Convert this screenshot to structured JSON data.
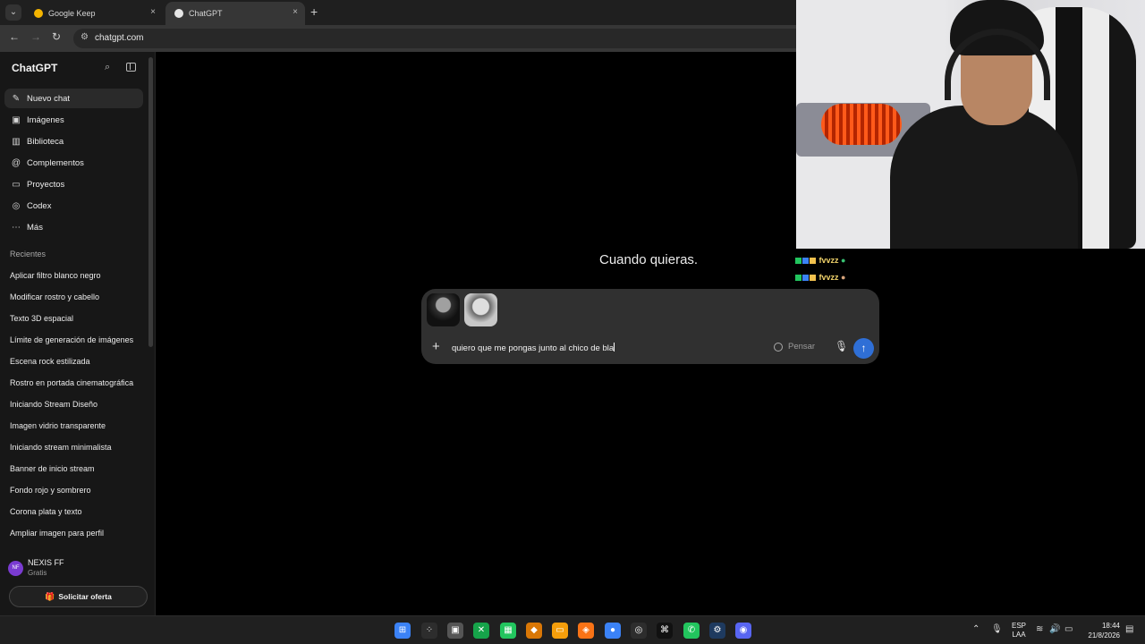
{
  "browser": {
    "tabs": [
      {
        "title": "Google Keep",
        "icon": "keep-icon"
      },
      {
        "title": "ChatGPT",
        "icon": "chatgpt-icon"
      }
    ],
    "url": "chatgpt.com"
  },
  "sidebar": {
    "brand": "ChatGPT",
    "nav_items": [
      {
        "label": "Nuevo chat",
        "icon": "edit-icon"
      },
      {
        "label": "Imágenes",
        "icon": "images-icon"
      },
      {
        "label": "Biblioteca",
        "icon": "library-icon"
      },
      {
        "label": "Complementos",
        "icon": "at-icon"
      },
      {
        "label": "Proyectos",
        "icon": "folder-icon"
      },
      {
        "label": "Codex",
        "icon": "codex-icon"
      },
      {
        "label": "Más",
        "icon": "more-icon"
      }
    ],
    "recent_title": "Recientes",
    "recent_items": [
      "Aplicar filtro blanco negro",
      "Modificar rostro y cabello",
      "Texto 3D espacial",
      "Límite de generación de imágenes",
      "Escena rock estilizada",
      "Rostro en portada cinematográfica",
      "Iniciando Stream Diseño",
      "Imagen vidrio transparente",
      "Iniciando stream minimalista",
      "Banner de inicio stream",
      "Fondo rojo y sombrero",
      "Corona plata y texto",
      "Ampliar imagen para perfil"
    ],
    "user": {
      "initials": "NF",
      "name": "NEXIS FF",
      "plan": "Gratis"
    },
    "offer_label": "Solicitar oferta"
  },
  "main": {
    "heading": "Cuando quieras.",
    "composer": {
      "text": "quiero que me pongas junto al chico de bla",
      "think_label": "Pensar"
    }
  },
  "overlay": {
    "chat_lines": [
      "fvvzz",
      "fvvzz"
    ]
  },
  "taskbar": {
    "language": [
      "ESP",
      "LAA"
    ],
    "time": "18:44",
    "date": "21/8/2026"
  },
  "colors": {
    "send_button": "#2f6fd6",
    "background": "#000000",
    "sidebar": "#171717"
  }
}
